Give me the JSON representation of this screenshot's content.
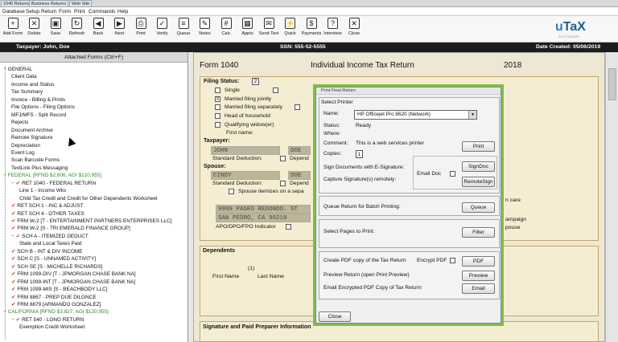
{
  "tabs": [
    "1040 Returns",
    "Business Returns",
    "Web Site"
  ],
  "menu": [
    "Database",
    "Setup",
    "Return",
    "Form",
    "Print",
    "Commands",
    "Help"
  ],
  "toolbar": [
    {
      "label": "Add Form",
      "icon": "add-form-icon",
      "glyph": "+"
    },
    {
      "label": "Delete",
      "icon": "delete-icon",
      "glyph": "✕"
    },
    {
      "label": "Save",
      "icon": "save-icon",
      "glyph": "▣"
    },
    {
      "label": "Refresh",
      "icon": "refresh-icon",
      "glyph": "↻"
    },
    {
      "label": "Back",
      "icon": "back-icon",
      "glyph": "◀"
    },
    {
      "label": "Next",
      "icon": "next-icon",
      "glyph": "▶"
    },
    {
      "label": "Print",
      "icon": "print-icon",
      "glyph": "⎙"
    },
    {
      "label": "Verify",
      "icon": "verify-icon",
      "glyph": "✓"
    },
    {
      "label": "Queue",
      "icon": "queue-icon",
      "glyph": "≡"
    },
    {
      "label": "Notes",
      "icon": "notes-icon",
      "glyph": "✎"
    },
    {
      "label": "Calc",
      "icon": "calc-icon",
      "glyph": "#"
    },
    {
      "label": "Appts",
      "icon": "appts-icon",
      "glyph": "▦"
    },
    {
      "label": "Send Text",
      "icon": "send-text-icon",
      "glyph": "✉"
    },
    {
      "label": "Quick",
      "icon": "quick-icon",
      "glyph": "⚡"
    },
    {
      "label": "Payments",
      "icon": "payments-icon",
      "glyph": "$"
    },
    {
      "label": "Interview",
      "icon": "interview-icon",
      "glyph": "?"
    },
    {
      "label": "Close",
      "icon": "close-icon",
      "glyph": "✕"
    }
  ],
  "logo": {
    "text_u": "u",
    "text_ta": "TaX",
    "sub": "SOFTWARE"
  },
  "infobar": {
    "taxpayer": "Taxpayer: John, Doe",
    "ssn": "SSN: 555-52-5555",
    "date": "Date Created: 05/06/2019"
  },
  "sidebar": {
    "header": "Attached Forms (Ctrl+F)",
    "items": [
      {
        "text": "GENERAL",
        "indent": 0,
        "color": "#111",
        "mark": "−"
      },
      {
        "text": "Client Data",
        "indent": 1,
        "color": "#111"
      },
      {
        "text": "Income and Status",
        "indent": 1,
        "color": "#111"
      },
      {
        "text": "Tax Summary",
        "indent": 1,
        "color": "#111"
      },
      {
        "text": "Invoice - Billing & Prints",
        "indent": 1,
        "color": "#111"
      },
      {
        "text": "File Options - Filing Options",
        "indent": 1,
        "color": "#111"
      },
      {
        "text": "MFJ/MFS - Split Record",
        "indent": 1,
        "color": "#111"
      },
      {
        "text": "Rejects",
        "indent": 1,
        "color": "#111"
      },
      {
        "text": "Document Archive",
        "indent": 1,
        "color": "#111"
      },
      {
        "text": "Remote Signature",
        "indent": 1,
        "color": "#111"
      },
      {
        "text": "Depreciation",
        "indent": 1,
        "color": "#111"
      },
      {
        "text": "Event Log",
        "indent": 1,
        "color": "#111"
      },
      {
        "text": "Scan Barcode Forms",
        "indent": 1,
        "color": "#111"
      },
      {
        "text": "TextLink Plus Messaging",
        "indent": 1,
        "color": "#111"
      },
      {
        "text": "FEDERAL [RFND $2,606, AGI $120,955]",
        "indent": 0,
        "color": "#2e8b2e",
        "mark": "−"
      },
      {
        "text": "RET 1040 - FEDERAL RETURN",
        "indent": 1,
        "color": "#111",
        "check": true,
        "mark": "−"
      },
      {
        "text": "Line 1 - Income Wks",
        "indent": 2,
        "color": "#111"
      },
      {
        "text": "Child Tax Credit and Credit for Other Dependents Worksheet",
        "indent": 2,
        "color": "#111"
      },
      {
        "text": "RET SCH 1 - INC & ADJUST",
        "indent": 1,
        "color": "#111",
        "check": true
      },
      {
        "text": "RET SCH 4 - OTHER TAXES",
        "indent": 1,
        "color": "#111",
        "check": true
      },
      {
        "text": "FRM W-2 [T - ENTERTAINMENT PARTNERS ENTERPRISES LLC]",
        "indent": 1,
        "color": "#111",
        "check": true
      },
      {
        "text": "FRM W-2 [S - TRI EMERALD FINANCE GROUP]",
        "indent": 1,
        "color": "#111",
        "check": true
      },
      {
        "text": "SCH A - ITEMIZED DEDUCT",
        "indent": 1,
        "color": "#111",
        "check": true,
        "mark": "−"
      },
      {
        "text": "State and Local Taxes Paid",
        "indent": 2,
        "color": "#111"
      },
      {
        "text": "SCH B - INT & DIV INCOME",
        "indent": 1,
        "color": "#111",
        "check": true
      },
      {
        "text": "SCH C [S - UNNAMED ACTIVITY]",
        "indent": 1,
        "color": "#111",
        "check": true
      },
      {
        "text": "SCH SE [S - MICHELLE RICHARDS]",
        "indent": 1,
        "color": "#111",
        "check": true
      },
      {
        "text": "FRM 1099-DIV [T - JPMORGAN CHASE BANK NA]",
        "indent": 1,
        "color": "#111",
        "check": true
      },
      {
        "text": "FRM 1099-INT [T - JPMORGAN CHASE BANK NA]",
        "indent": 1,
        "color": "#111",
        "check": true
      },
      {
        "text": "FRM 1099-MIS [S - BEACHBODY LLC]",
        "indent": 1,
        "color": "#111",
        "check": true
      },
      {
        "text": "FRM 8867 - PREP DUE DILGNCE",
        "indent": 1,
        "color": "#111",
        "check": true
      },
      {
        "text": "FRM 8879 [ARMANDO GONZALEZ]",
        "indent": 1,
        "color": "#111",
        "check": true
      },
      {
        "text": "CALIFORNIA [RFND $3,827, AGI $120,955]",
        "indent": 0,
        "color": "#2e8b2e",
        "mark": "−"
      },
      {
        "text": "RET 540 - LONG RETURN",
        "indent": 1,
        "color": "#111",
        "check": true,
        "mark": "−"
      },
      {
        "text": "Exemption Credit Worksheet",
        "indent": 2,
        "color": "#111"
      }
    ]
  },
  "form": {
    "title_left": "Form 1040",
    "title_center": "Individual Income Tax Return",
    "year": "2018",
    "filing_status": "Filing Status:",
    "filing_status_value": "2",
    "options": [
      "Single",
      "Married filing jointly",
      "Married filing separately",
      "Head of household",
      "Qualifying widow(er)"
    ],
    "first_name_label": "First name:",
    "taxpayer_label": "Taxpayer:",
    "taxpayer_first": "JOHN",
    "taxpayer_last": "DOE",
    "std_deduction": "Standard Deduction:",
    "dependent_short": "Depend",
    "spouse_label": "Spouse:",
    "spouse_first": "CINDY",
    "spouse_last": "DOE",
    "spouse_itemizes": "Spouse itemizes on a sepa",
    "address1": "9999 PASEO REDONDO. ST",
    "address2": "SAN PEDRO, CA 90210",
    "apo": "APO/DPO/FPO Indicator",
    "dependents": "Dependents",
    "dep_num": "(1)",
    "first_name_col": "First Name",
    "last_name_col": "Last Name",
    "signature": "Signature and Paid Preparer Information",
    "right_frag1": "n care",
    "right_frag2": "ampaign",
    "right_frag3": "pouse"
  },
  "dialog": {
    "title": "Print Final Return",
    "select_printer": "Select Printer",
    "name_label": "Name:",
    "printer_name": "HP Officejet Pro 8620 (Network)",
    "status_label": "Status:",
    "status_value": "Ready",
    "where_label": "Where:",
    "comment_label": "Comment:",
    "comment_value": "This is a web services printer",
    "copies_label": "Copies:",
    "copies_value": "1",
    "print_btn": "Print",
    "sign_esig": "Sign Documents with E-Signature:",
    "capture_sig": "Capture Signature(s) remotely:",
    "email_doc": "Email Doc",
    "signdoc_btn": "SignDoc",
    "remotesign_btn": "RemoteSign",
    "queue_label": "Queue Return for Batch Printing:",
    "queue_btn": "Queue",
    "select_pages": "Select Pages to Print:",
    "filter_btn": "Filter",
    "pdf_label": "Create PDF copy of the Tax Return",
    "encrypt_pdf": "Encrypt PDF",
    "pdf_btn": "PDF",
    "preview_label": "Preview Return (open Print Preview)",
    "preview_btn": "Preview",
    "email_label": "Email Encrypted PDF Copy of Tax Return:",
    "email_btn": "Email",
    "close_btn": "Close"
  }
}
